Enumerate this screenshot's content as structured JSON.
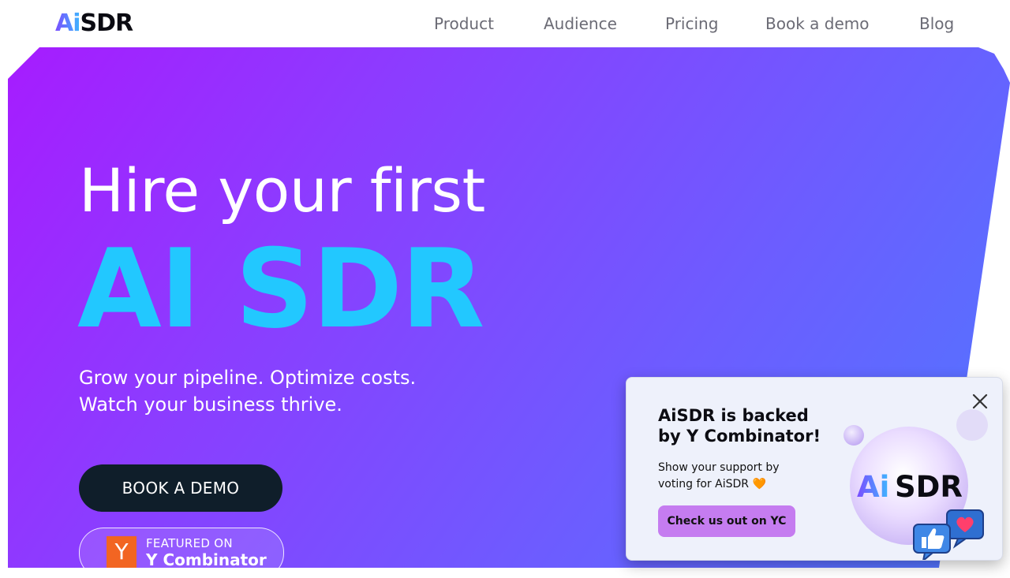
{
  "header": {
    "logo_ai": "Ai",
    "logo_sdr": "SDR",
    "nav": [
      "Product",
      "Audience",
      "Pricing",
      "Book a demo",
      "Blog"
    ]
  },
  "hero": {
    "title_line1": "Hire your first",
    "title_line2": "AI SDR",
    "subtitle_line1": "Grow your pipeline. Optimize costs.",
    "subtitle_line2": "Watch your business thrive.",
    "cta_label": "BOOK A DEMO",
    "badge_logo": "Y",
    "badge_small": "FEATURED ON",
    "badge_big": "Y Combinator"
  },
  "popup": {
    "title": "AiSDR is backed by Y Combinator!",
    "text": "Show your support by voting for AiSDR 🧡",
    "button_label": "Check us out on YC",
    "art_logo_ai": "Ai",
    "art_logo_sdr": "SDR"
  },
  "colors": {
    "hero_gradient_start": "#a61cff",
    "hero_gradient_end": "#4f78ff",
    "accent_cyan": "#22c8ff",
    "cta_dark": "#0f1e2a",
    "popup_button": "#c57cf0",
    "yc_orange": "#f26522"
  }
}
